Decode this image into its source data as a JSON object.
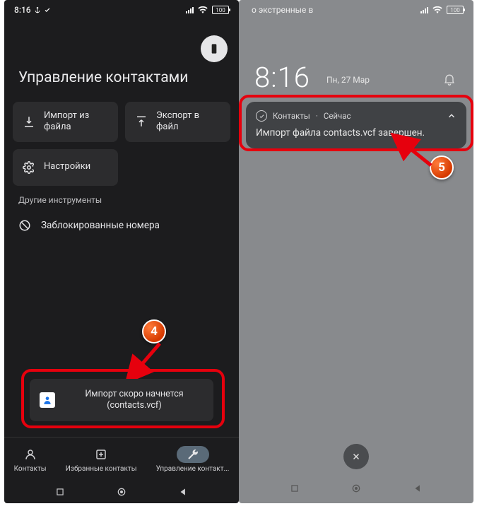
{
  "left": {
    "status": {
      "time": "8:16",
      "battery": "100"
    },
    "title": "Управление контактами",
    "tiles": {
      "import": "Импорт из файла",
      "export": "Экспорт в файл",
      "settings": "Настройки"
    },
    "section_label": "Другие инструменты",
    "blocked": "Заблокированные номера",
    "toast": {
      "line1": "Импорт скоро начнется",
      "line2": "(contacts.vcf)"
    },
    "tabs": {
      "contacts": "Контакты",
      "favorites": "Избранные контакты",
      "manage": "Управление контакт..."
    },
    "step": "4"
  },
  "right": {
    "status": {
      "carrier_msg": "о экстренные в",
      "battery": "100"
    },
    "clock": "8:16",
    "date": "Пн, 27 Мар",
    "notif": {
      "app": "Контакты",
      "when": "Сейчас",
      "message": "Импорт файла contacts.vcf завершен."
    },
    "step": "5"
  }
}
